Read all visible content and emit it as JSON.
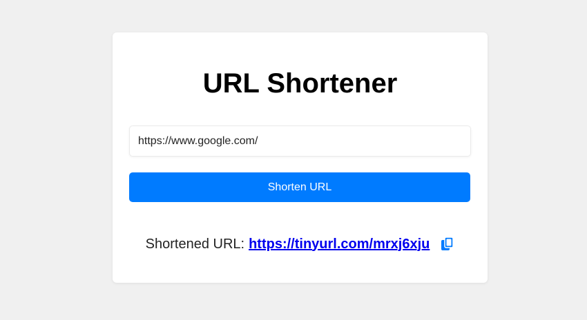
{
  "page": {
    "title": "URL Shortener"
  },
  "form": {
    "input_value": "https://www.google.com/",
    "button_label": "Shorten URL"
  },
  "result": {
    "label": "Shortened URL:",
    "short_url": "https://tinyurl.com/mrxj6xju",
    "copy_icon": "copy-icon"
  },
  "colors": {
    "background": "#f0f0f0",
    "card": "#ffffff",
    "accent": "#007bff",
    "link": "#0000ee"
  }
}
